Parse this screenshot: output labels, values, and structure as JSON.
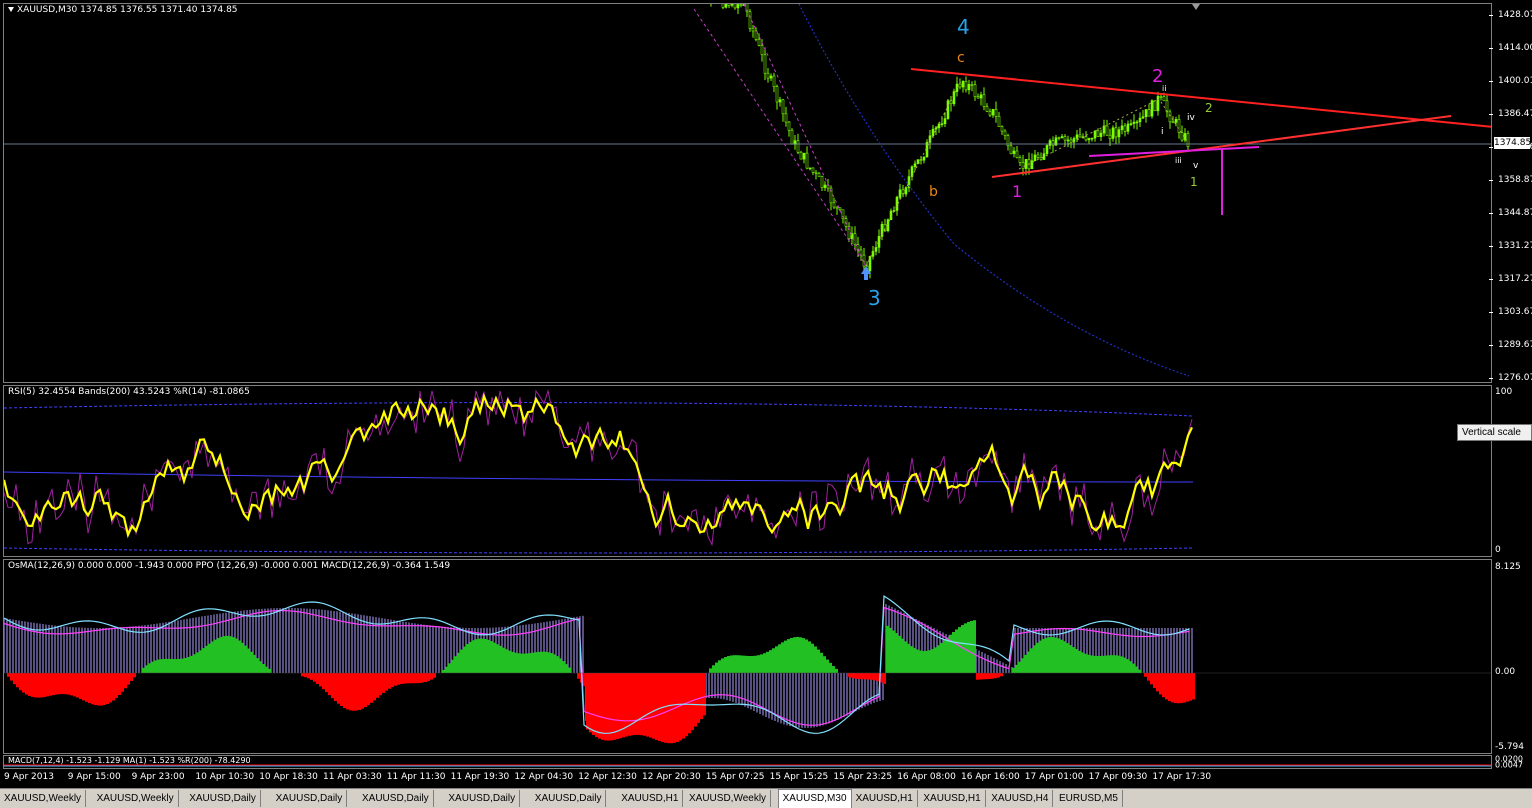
{
  "main": {
    "title": "XAUUSD,M30  1374.85 1376.55 1371.40 1374.85",
    "current_price": "1374.85",
    "price_labels": [
      "1428.07",
      "1414.00",
      "1400.01",
      "1386.47",
      "1372.06",
      "1358.87",
      "1344.87",
      "1331.27",
      "1317.27",
      "1303.67",
      "1289.67",
      "1276.07"
    ],
    "wave_labels": [
      {
        "text": "4",
        "color": "#29a3e8"
      },
      {
        "text": "3",
        "color": "#29a3e8"
      },
      {
        "text": "c",
        "color": "#e8861a"
      },
      {
        "text": "b",
        "color": "#e8861a"
      },
      {
        "text": "1",
        "color": "#e020e0"
      },
      {
        "text": "2",
        "color": "#e020e0"
      },
      {
        "text": "ii",
        "color": "#ffffff"
      },
      {
        "text": "iv",
        "color": "#ffffff"
      },
      {
        "text": "i",
        "color": "#ffffff"
      },
      {
        "text": "iii",
        "color": "#ffffff"
      },
      {
        "text": "v",
        "color": "#ffffff"
      },
      {
        "text": "2",
        "color": "#9acd32"
      },
      {
        "text": "1",
        "color": "#9acd32"
      }
    ]
  },
  "rsi": {
    "title": "RSI(5) 32.4554  Bands(200) 43.5243  %R(14) -81.0865",
    "scale": [
      "100",
      "0"
    ],
    "tooltip": "Vertical scale"
  },
  "macd": {
    "title": "OsMA(12,26,9) 0.000 0.000 -1.943 0.000  PPO (12,26,9) -0.000 0.001  MACD(12,26,9) -0.364 1.549",
    "scale": [
      "8.125",
      "0.00",
      "-5.794"
    ]
  },
  "macd2": {
    "title": "MACD(7,12,4) -1.523 -1.129  MA(1) -1.523  %R(200) -78.4290",
    "scale": [
      "0.0200",
      "0.0047"
    ]
  },
  "time_labels": [
    "9 Apr 2013",
    "9 Apr 15:00",
    "9 Apr 23:00",
    "10 Apr 10:30",
    "10 Apr 18:30",
    "11 Apr 03:30",
    "11 Apr 11:30",
    "11 Apr 19:30",
    "12 Apr 04:30",
    "12 Apr 12:30",
    "12 Apr 20:30",
    "15 Apr 07:25",
    "15 Apr 15:25",
    "15 Apr 23:25",
    "16 Apr 08:00",
    "16 Apr 16:00",
    "17 Apr 01:00",
    "17 Apr 09:30",
    "17 Apr 17:30"
  ],
  "tabs": [
    {
      "label": "XAUUSD,Weekly",
      "active": false
    },
    {
      "label": "XAUUSD,Weekly",
      "active": false
    },
    {
      "label": "XAUUSD,Daily",
      "active": false
    },
    {
      "label": "XAUUSD,Daily",
      "active": false
    },
    {
      "label": "XAUUSD,Daily",
      "active": false
    },
    {
      "label": "XAUUSD,Daily",
      "active": false
    },
    {
      "label": "XAUUSD,Daily",
      "active": false
    },
    {
      "label": "XAUUSD,H1",
      "active": false
    },
    {
      "label": "XAUUSD,Weekly",
      "active": false
    },
    {
      "label": "XAUUSD,M30",
      "active": true
    },
    {
      "label": "XAUUSD,H1",
      "active": false
    },
    {
      "label": "XAUUSD,H1",
      "active": false
    },
    {
      "label": "XAUUSD,H4",
      "active": false
    },
    {
      "label": "EURUSD,M5",
      "active": false
    }
  ],
  "colors": {
    "bull_candle": "#7cfc00",
    "resistance_line": "#ff2020",
    "support_line": "#ff3030",
    "magenta": "#e020e0",
    "rsi_line": "#ffff00",
    "bands": "#4040ff",
    "osma_pos": "#22c022",
    "osma_neg": "#ff0000",
    "macd_hist": "#b0a0ff",
    "macd_signal": "#ff40ff",
    "macd_line": "#80e0ff"
  }
}
